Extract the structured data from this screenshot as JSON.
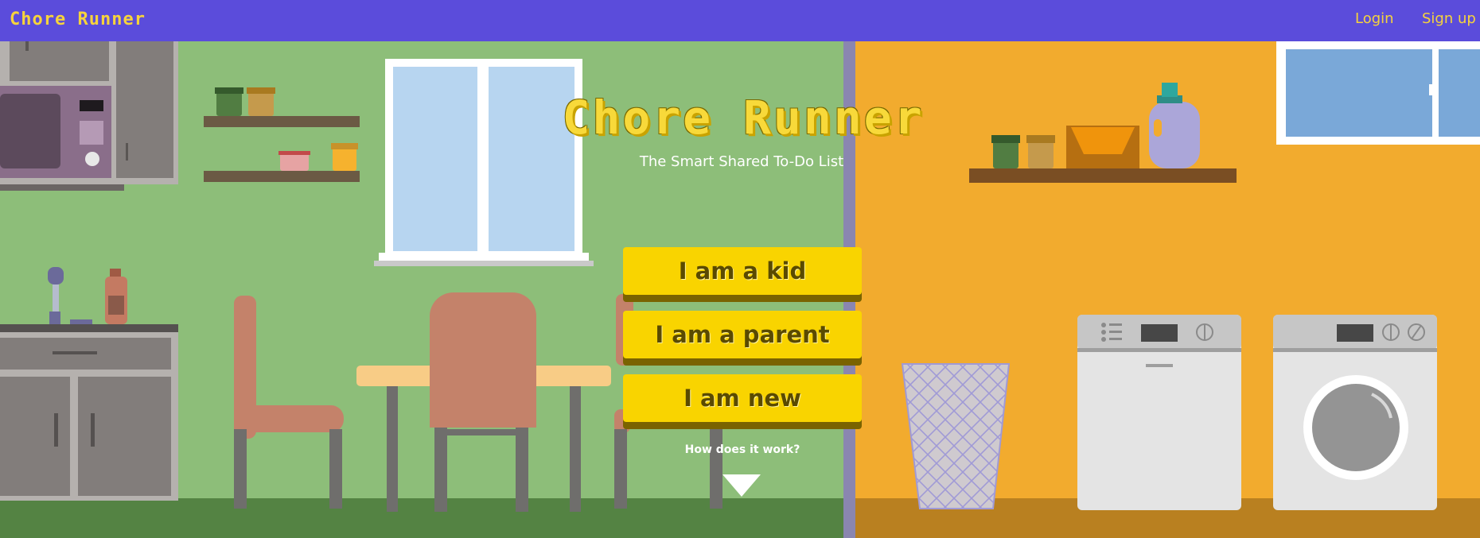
{
  "nav": {
    "brand": "Chore Runner",
    "login": "Login",
    "signup": "Sign up"
  },
  "hero": {
    "title": "Chore Runner",
    "subtitle": "The Smart Shared To-Do List"
  },
  "choices": {
    "kid": "I am a kid",
    "parent": "I am a parent",
    "new": "I am new"
  },
  "how": {
    "label": "How does it work?",
    "icon": "chevron-down-icon"
  },
  "colors": {
    "nav": "#5b4cdb",
    "accent": "#f9d400",
    "kitchen_wall": "#8dbe79",
    "laundry_wall": "#f2ab2e"
  }
}
